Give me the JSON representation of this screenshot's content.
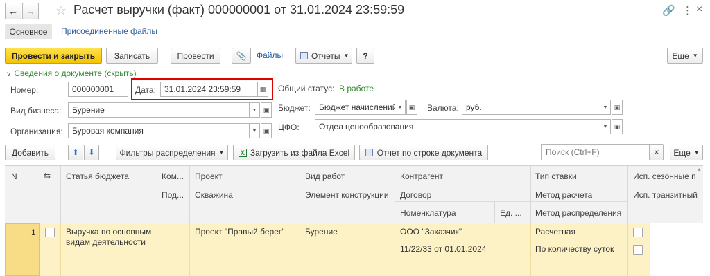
{
  "window": {
    "title": "Расчет выручки (факт) 000000001 от 31.01.2024 23:59:59"
  },
  "tabs": [
    {
      "label": "Основное"
    },
    {
      "label": "Присоединенные файлы"
    }
  ],
  "toolbar": {
    "post_close": "Провести и закрыть",
    "save": "Записать",
    "post": "Провести",
    "files": "Файлы",
    "reports": "Отчеты",
    "help": "?",
    "more": "Еще"
  },
  "section": {
    "toggle": "Сведения о документе (скрыть)"
  },
  "form": {
    "number_label": "Номер:",
    "number_value": "000000001",
    "date_label": "Дата:",
    "date_value": "31.01.2024 23:59:59",
    "status_label": "Общий статус:",
    "status_value": "В работе",
    "business_label": "Вид бизнеса:",
    "business_value": "Бурение",
    "budget_label": "Бюджет:",
    "budget_value": "Бюджет начислений",
    "currency_label": "Валюта:",
    "currency_value": "руб.",
    "org_label": "Организация:",
    "org_value": "Буровая компания",
    "cfo_label": "ЦФО:",
    "cfo_value": "Отдел ценообразования"
  },
  "table_toolbar": {
    "add": "Добавить",
    "filters": "Фильтры распределения",
    "load_excel": "Загрузить из файла Excel",
    "report_row": "Отчет по строке документа",
    "search_placeholder": "Поиск (Ctrl+F)",
    "clear": "×",
    "more": "Еще"
  },
  "columns": {
    "n": "N",
    "budget_item": "Статья бюджета",
    "com": "Ком...",
    "pod": "Под...",
    "project": "Проект",
    "well": "Скважина",
    "work_type": "Вид работ",
    "construction": "Элемент конструкции",
    "counterparty": "Контрагент",
    "contract": "Договор",
    "nomenclature": "Номенклатура",
    "unit": "Ед. ...",
    "rate_type": "Тип ставки",
    "calc_method": "Метод расчета",
    "distribution_method": "Метод распределения",
    "seasonal": "Исп. сезонные п",
    "transit": "Исп. транзитный"
  },
  "rows": [
    {
      "n": "1",
      "budget_item_line1": "Выручка по основным",
      "budget_item_line2": "видам деятельности",
      "project": "Проект \"Правый берег\"",
      "work_type": "Бурение",
      "counterparty": "ООО \"Заказчик\"",
      "contract": "11/22/33 от 01.01.2024",
      "rate_type": "Расчетная",
      "calc_method": "По количеству суток"
    }
  ],
  "colors": {
    "primary_button": "#f5c400",
    "highlight_border": "#e00000",
    "status_green": "#2f8a2f",
    "link_blue": "#2a5a9c",
    "row_selected": "#fdf1c6"
  }
}
